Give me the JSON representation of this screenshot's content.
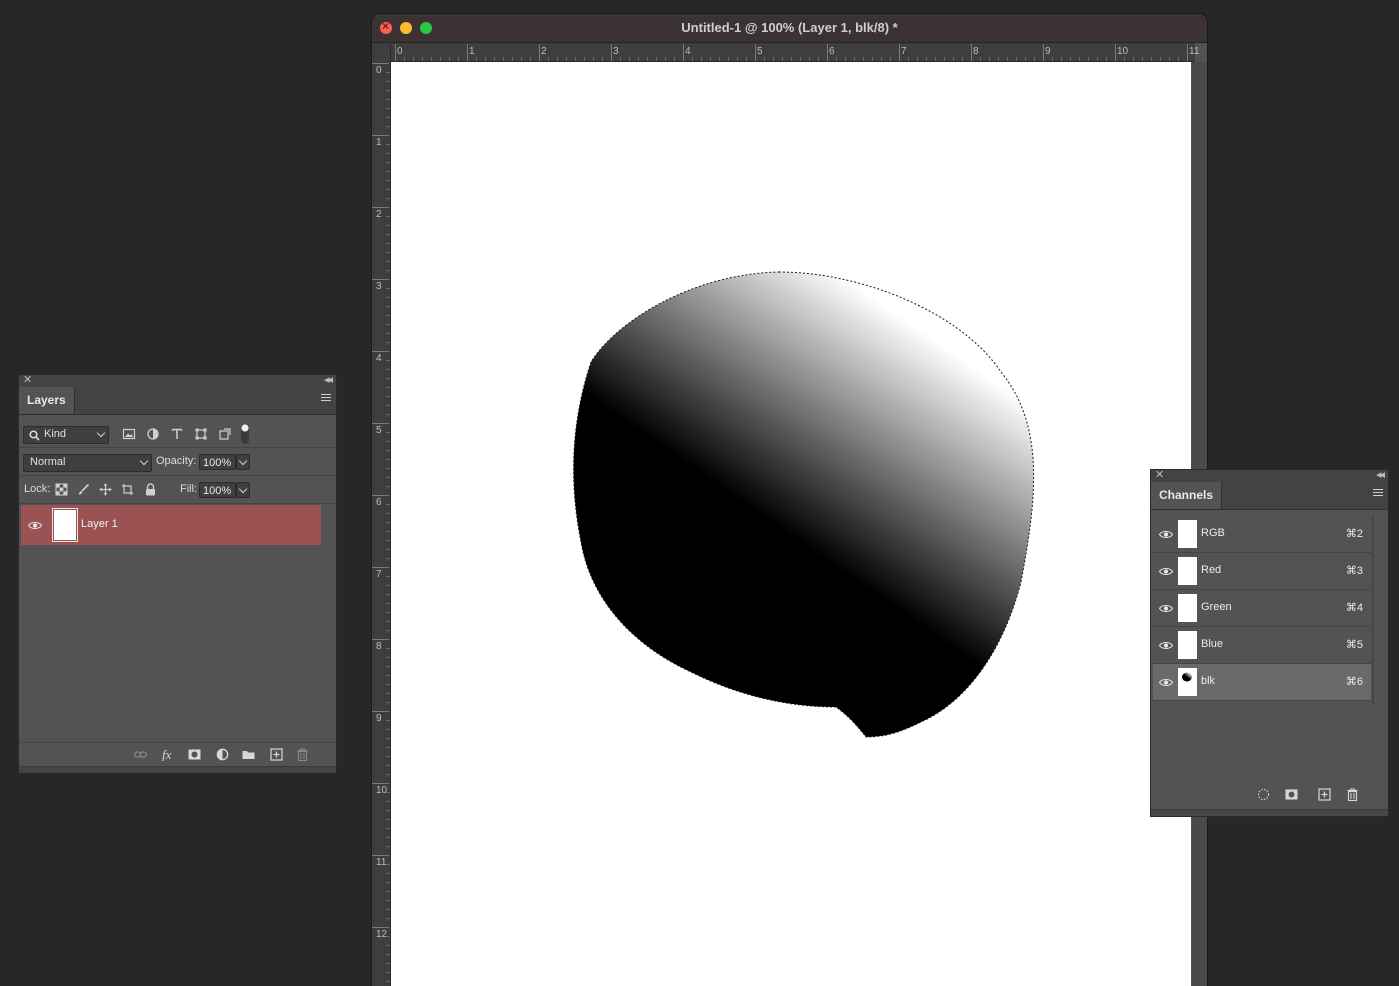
{
  "document": {
    "title": "Untitled-1 @ 100% (Layer 1, blk/8) *",
    "ruler_top_labels": [
      "0",
      "1",
      "2",
      "3",
      "4",
      "5",
      "6",
      "7",
      "8",
      "9",
      "10",
      "11"
    ],
    "ruler_left_labels": [
      "0",
      "1",
      "2",
      "3",
      "4",
      "5",
      "6",
      "7",
      "8",
      "9",
      "10",
      "11",
      "12"
    ]
  },
  "layers_panel": {
    "tab_label": "Layers",
    "filter_kind": "Kind",
    "blend_mode": "Normal",
    "opacity_label": "Opacity:",
    "opacity_value": "100%",
    "lock_label": "Lock:",
    "fill_label": "Fill:",
    "fill_value": "100%",
    "layers": [
      {
        "name": "Layer 1",
        "visible": true,
        "selected": true,
        "highlight_color": "#9b5252"
      }
    ],
    "footer_icons": [
      "link-icon",
      "fx-icon",
      "mask-icon",
      "adjustment-icon",
      "folder-icon",
      "new-layer-icon",
      "trash-icon"
    ]
  },
  "channels_panel": {
    "tab_label": "Channels",
    "channels": [
      {
        "name": "RGB",
        "shortcut": "⌘2",
        "visible": true,
        "active": false
      },
      {
        "name": "Red",
        "shortcut": "⌘3",
        "visible": true,
        "active": false
      },
      {
        "name": "Green",
        "shortcut": "⌘4",
        "visible": true,
        "active": false
      },
      {
        "name": "Blue",
        "shortcut": "⌘5",
        "visible": true,
        "active": false
      },
      {
        "name": "blk",
        "shortcut": "⌘6",
        "visible": true,
        "active": true
      }
    ],
    "footer_icons": [
      "load-selection-icon",
      "save-selection-icon",
      "new-channel-icon",
      "trash-icon"
    ]
  },
  "colors": {
    "app_background": "#272727",
    "panel_background": "#535353",
    "selected_layer": "#9b5252",
    "canvas": "#ffffff"
  }
}
